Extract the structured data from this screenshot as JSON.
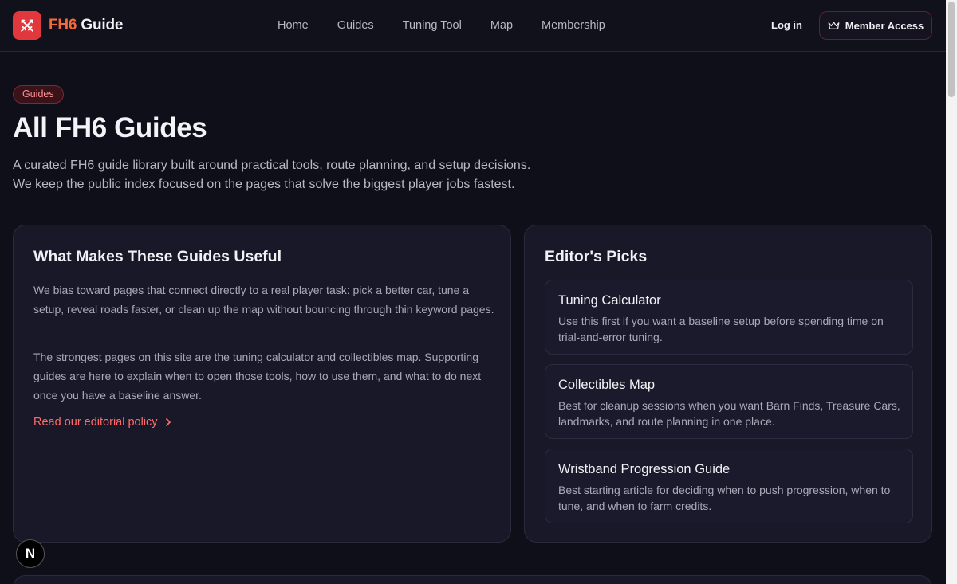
{
  "header": {
    "logo_accent": "FH6",
    "logo_text": "Guide",
    "nav": [
      "Home",
      "Guides",
      "Tuning Tool",
      "Map",
      "Membership"
    ],
    "login_label": "Log in",
    "member_label": "Member Access"
  },
  "hero": {
    "badge": "Guides",
    "title": "All FH6 Guides",
    "subtitle_line1": "A curated FH6 guide library built around practical tools, route planning, and setup decisions.",
    "subtitle_line2": "We keep the public index focused on the pages that solve the biggest player jobs fastest."
  },
  "useful": {
    "title": "What Makes These Guides Useful",
    "para1": "We bias toward pages that connect directly to a real player task: pick a better car, tune a setup, reveal roads faster, or clean up the map without bouncing through thin keyword pages.",
    "para2": "The strongest pages on this site are the tuning calculator and collectibles map. Supporting guides are here to explain when to open those tools, how to use them, and what to do next once you have a baseline answer.",
    "link_label": "Read our editorial policy"
  },
  "picks": {
    "title": "Editor's Picks",
    "items": [
      {
        "title": "Tuning Calculator",
        "desc": "Use this first if you want a baseline setup before spending time on trial-and-error tuning."
      },
      {
        "title": "Collectibles Map",
        "desc": "Best for cleanup sessions when you want Barn Finds, Treasure Cars, landmarks, and route planning in one place."
      },
      {
        "title": "Wristband Progression Guide",
        "desc": "Best starting article for deciding when to push progression, when to tune, and when to farm credits."
      }
    ]
  },
  "dev_badge": "N",
  "colors": {
    "background": "#0f0f19",
    "card": "#181828",
    "accent": "#e0383c",
    "link": "#ff6b6b"
  }
}
